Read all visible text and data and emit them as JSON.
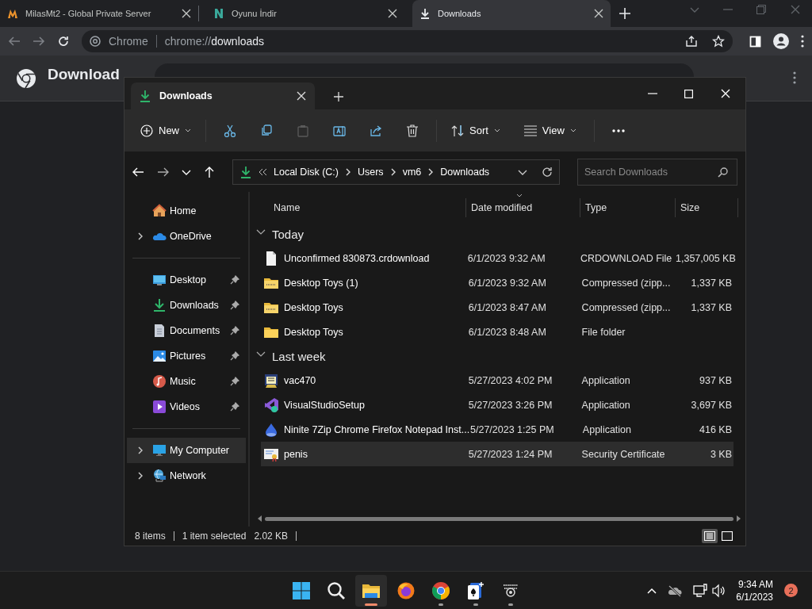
{
  "browser": {
    "tabs": [
      {
        "title": "MilasMt2 - Global Private Server",
        "kind": "site-m",
        "selected": false
      },
      {
        "title": "Oyunu İndir",
        "kind": "site-n",
        "selected": false
      },
      {
        "title": "Downloads",
        "kind": "download",
        "selected": true
      }
    ],
    "address": {
      "label": "Chrome",
      "url_scheme": "chrome://",
      "url_page": "downloads"
    },
    "page_title": "Download"
  },
  "explorer": {
    "tab_title": "Downloads",
    "toolbar": {
      "new": "New",
      "sort": "Sort",
      "view": "View"
    },
    "path": [
      "Local Disk (C:)",
      "Users",
      "vm6",
      "Downloads"
    ],
    "search": {
      "placeholder": "Search Downloads"
    },
    "sidebar": [
      [
        {
          "label": "Home",
          "kind": "home",
          "expandable": false,
          "pinned": false,
          "selected": false
        },
        {
          "label": "OneDrive",
          "kind": "cloud",
          "expandable": true,
          "pinned": false,
          "selected": false
        }
      ],
      [
        {
          "label": "Desktop",
          "kind": "desktop",
          "expandable": false,
          "pinned": true,
          "selected": false
        },
        {
          "label": "Downloads",
          "kind": "download",
          "expandable": false,
          "pinned": true,
          "selected": false
        },
        {
          "label": "Documents",
          "kind": "documents",
          "expandable": false,
          "pinned": true,
          "selected": false
        },
        {
          "label": "Pictures",
          "kind": "pictures",
          "expandable": false,
          "pinned": true,
          "selected": false
        },
        {
          "label": "Music",
          "kind": "music",
          "expandable": false,
          "pinned": true,
          "selected": false
        },
        {
          "label": "Videos",
          "kind": "videos",
          "expandable": false,
          "pinned": true,
          "selected": false
        }
      ],
      [
        {
          "label": "My Computer",
          "kind": "computer",
          "expandable": true,
          "pinned": false,
          "selected": true
        },
        {
          "label": "Network",
          "kind": "network",
          "expandable": true,
          "pinned": false,
          "selected": false
        }
      ]
    ],
    "columns": [
      {
        "label": "Name",
        "sorted": false
      },
      {
        "label": "Date modified",
        "sorted": true
      },
      {
        "label": "Type",
        "sorted": false
      },
      {
        "label": "Size",
        "sorted": false
      }
    ],
    "groups": [
      {
        "label": "Today",
        "expanded": true,
        "files": [
          {
            "name": "Unconfirmed 830873.crdownload",
            "date": "6/1/2023 9:32 AM",
            "type": "CRDOWNLOAD File",
            "size": "1,357,005 KB",
            "kind": "file",
            "selected": false
          },
          {
            "name": "Desktop Toys (1)",
            "date": "6/1/2023 9:32 AM",
            "type": "Compressed (zipp...",
            "size": "1,337 KB",
            "kind": "zip",
            "selected": false
          },
          {
            "name": "Desktop Toys",
            "date": "6/1/2023 8:47 AM",
            "type": "Compressed (zipp...",
            "size": "1,337 KB",
            "kind": "zip",
            "selected": false
          },
          {
            "name": "Desktop Toys",
            "date": "6/1/2023 8:48 AM",
            "type": "File folder",
            "kind": "folder",
            "selected": false
          }
        ]
      },
      {
        "label": "Last week",
        "expanded": true,
        "files": [
          {
            "name": "vac470",
            "date": "5/27/2023 4:02 PM",
            "type": "Application",
            "size": "937 KB",
            "kind": "app",
            "selected": false
          },
          {
            "name": "VisualStudioSetup",
            "date": "5/27/2023 3:26 PM",
            "type": "Application",
            "size": "3,697 KB",
            "kind": "installer",
            "selected": false
          },
          {
            "name": "Ninite 7Zip Chrome Firefox Notepad Inst...",
            "date": "5/27/2023 1:25 PM",
            "type": "Application",
            "size": "416 KB",
            "kind": "drop",
            "selected": false
          },
          {
            "name": "penis",
            "date": "5/27/2023 1:24 PM",
            "type": "Security Certificate",
            "size": "3 KB",
            "kind": "certificate",
            "selected": true
          }
        ]
      }
    ],
    "status": {
      "count": "8 items",
      "selection": "1 item selected",
      "selection_size": "2.02 KB"
    },
    "views": [
      {
        "kind": "details",
        "selected": true
      },
      {
        "kind": "tiles",
        "selected": false
      }
    ]
  },
  "taskbar": {
    "apps": [
      {
        "kind": "start",
        "running": false,
        "active": false
      },
      {
        "kind": "search",
        "running": false,
        "active": false
      },
      {
        "kind": "explorer",
        "running": true,
        "active": true
      },
      {
        "kind": "firefox",
        "running": false,
        "active": false
      },
      {
        "kind": "chrome",
        "running": true,
        "active": false
      },
      {
        "kind": "cards",
        "running": true,
        "active": false
      },
      {
        "kind": "toys",
        "running": true,
        "active": false
      }
    ],
    "time": "9:34 AM",
    "date": "6/1/2023",
    "notifications": "2"
  }
}
